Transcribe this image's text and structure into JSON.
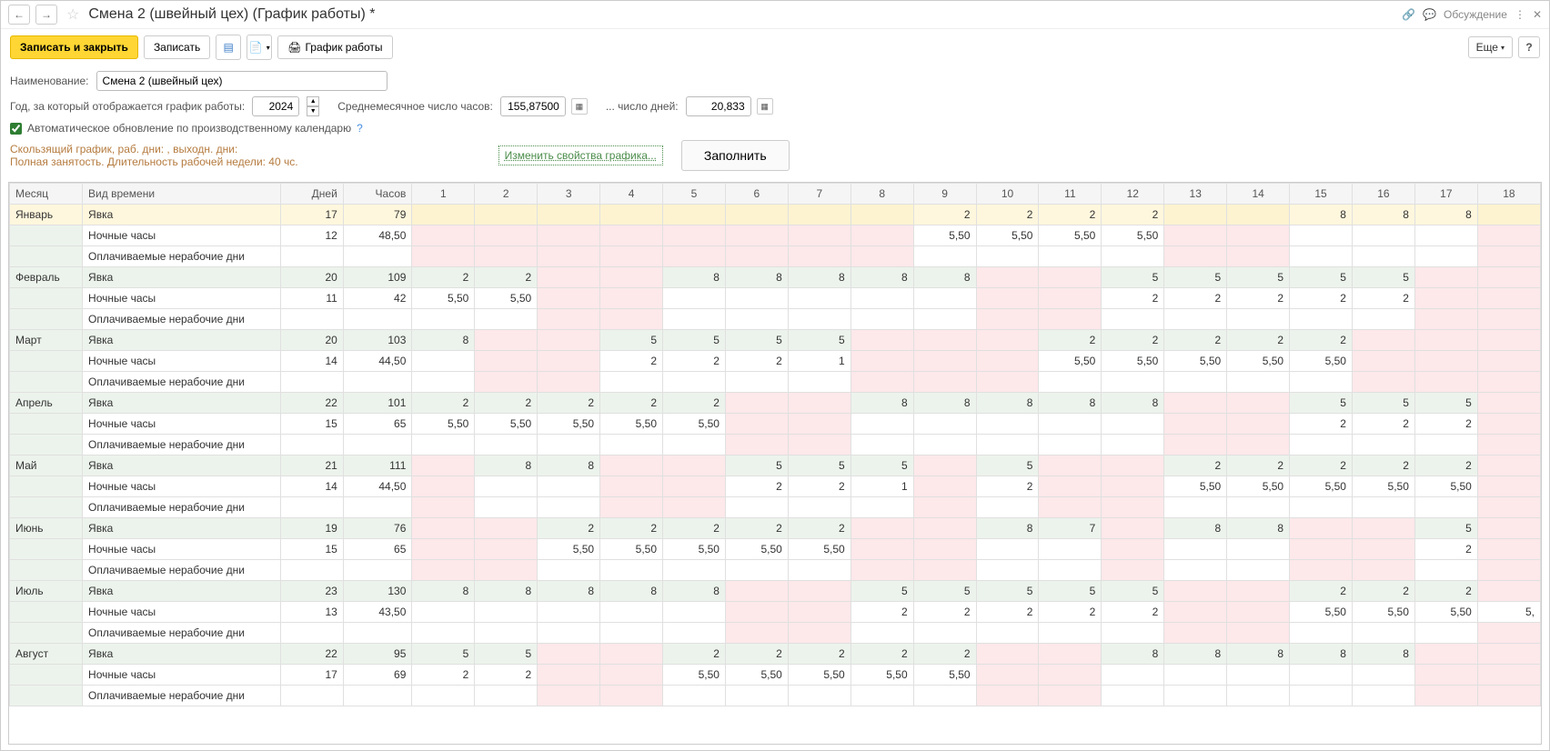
{
  "titlebar": {
    "title": "Смена 2 (швейный цех) (График работы) *",
    "discuss": "Обсуждение"
  },
  "toolbar": {
    "save_close": "Записать и закрыть",
    "save": "Записать",
    "schedule_btn": "График работы",
    "more": "Еще"
  },
  "form": {
    "name_label": "Наименование:",
    "name_value": "Смена 2 (швейный цех)",
    "year_label": "Год, за который отображается график работы:",
    "year_value": "2024",
    "avg_hours_label": "Среднемесячное число часов:",
    "avg_hours_value": "155,87500",
    "avg_days_label": "... число дней:",
    "avg_days_value": "20,833",
    "cb_label": "Автоматическое обновление по производственному календарю",
    "info1": "Скользящий график, раб. дни: , выходн. дни:",
    "info2": "Полная занятость. Длительность рабочей недели: 40 чс.",
    "change_link": "Изменить свойства графика...",
    "fill_btn": "Заполнить"
  },
  "grid": {
    "headers": {
      "month": "Месяц",
      "type": "Вид времени",
      "days": "Дней",
      "hours": "Часов"
    },
    "day_cols": [
      "1",
      "2",
      "3",
      "4",
      "5",
      "6",
      "7",
      "8",
      "9",
      "10",
      "11",
      "12",
      "13",
      "14",
      "15",
      "16",
      "17",
      "18"
    ],
    "type_labels": [
      "Явка",
      "Ночные часы",
      "Оплачиваемые нерабочие дни"
    ],
    "months": [
      {
        "name": "Январь",
        "days": "17",
        "hours": "79",
        "r1": {
          "cells": [
            "",
            "",
            "",
            "",
            "",
            "",
            "",
            "",
            "2",
            "2",
            "2",
            "2",
            "",
            "",
            "8",
            "8",
            "8",
            ""
          ],
          "pink": [
            0,
            1,
            2,
            3,
            4,
            5,
            6,
            7,
            12,
            13,
            17
          ]
        },
        "r2": {
          "cells": [
            "",
            "",
            "",
            "",
            "",
            "",
            "",
            "",
            "5,50",
            "5,50",
            "5,50",
            "5,50",
            "",
            "",
            "",
            "",
            "",
            ""
          ],
          "pink": [
            0,
            1,
            2,
            3,
            4,
            5,
            6,
            7,
            12,
            13,
            17
          ]
        },
        "r3": {
          "cells": [
            "",
            "",
            "",
            "",
            "",
            "",
            "",
            "",
            "",
            "",
            "",
            "",
            "",
            "",
            "",
            "",
            "",
            ""
          ],
          "pink": [
            0,
            1,
            2,
            3,
            4,
            5,
            6,
            7,
            12,
            13,
            17
          ]
        }
      },
      {
        "name": "Февраль",
        "days": "20",
        "hours": "109",
        "r1": {
          "cells": [
            "2",
            "2",
            "",
            "",
            "8",
            "8",
            "8",
            "8",
            "8",
            "",
            "",
            "5",
            "5",
            "5",
            "5",
            "5",
            "",
            ""
          ],
          "pink": [
            2,
            3,
            9,
            10,
            16,
            17
          ]
        },
        "r2": {
          "cells": [
            "5,50",
            "5,50",
            "",
            "",
            "",
            "",
            "",
            "",
            "",
            "",
            "",
            "2",
            "2",
            "2",
            "2",
            "2",
            "",
            ""
          ],
          "pink": [
            2,
            3,
            9,
            10,
            16,
            17
          ]
        },
        "r3": {
          "cells": [
            "",
            "",
            "",
            "",
            "",
            "",
            "",
            "",
            "",
            "",
            "",
            "",
            "",
            "",
            "",
            "",
            "",
            ""
          ],
          "pink": [
            2,
            3,
            9,
            10,
            16,
            17
          ]
        },
        "days2": "11",
        "hours2": "42"
      },
      {
        "name": "Март",
        "days": "20",
        "hours": "103",
        "r1": {
          "cells": [
            "8",
            "",
            "",
            "5",
            "5",
            "5",
            "5",
            "",
            "",
            "",
            "2",
            "2",
            "2",
            "2",
            "2",
            "",
            "",
            ""
          ],
          "pink": [
            1,
            2,
            7,
            8,
            9,
            15,
            16,
            17
          ]
        },
        "r2": {
          "cells": [
            "",
            "",
            "",
            "2",
            "2",
            "2",
            "1",
            "",
            "",
            "",
            "5,50",
            "5,50",
            "5,50",
            "5,50",
            "5,50",
            "",
            "",
            ""
          ],
          "pink": [
            1,
            2,
            7,
            8,
            9,
            15,
            16,
            17
          ]
        },
        "r3": {
          "cells": [
            "",
            "",
            "",
            "",
            "",
            "",
            "",
            "",
            "",
            "",
            "",
            "",
            "",
            "",
            "",
            "",
            "",
            ""
          ],
          "pink": [
            1,
            2,
            7,
            8,
            9,
            15,
            16,
            17
          ]
        },
        "days2": "14",
        "hours2": "44,50"
      },
      {
        "name": "Апрель",
        "days": "22",
        "hours": "101",
        "r1": {
          "cells": [
            "2",
            "2",
            "2",
            "2",
            "2",
            "",
            "",
            "8",
            "8",
            "8",
            "8",
            "8",
            "",
            "",
            "5",
            "5",
            "5",
            ""
          ],
          "pink": [
            5,
            6,
            12,
            13,
            17
          ]
        },
        "r2": {
          "cells": [
            "5,50",
            "5,50",
            "5,50",
            "5,50",
            "5,50",
            "",
            "",
            "",
            "",
            "",
            "",
            "",
            "",
            "",
            "2",
            "2",
            "2",
            ""
          ],
          "pink": [
            5,
            6,
            12,
            13,
            17
          ]
        },
        "r3": {
          "cells": [
            "",
            "",
            "",
            "",
            "",
            "",
            "",
            "",
            "",
            "",
            "",
            "",
            "",
            "",
            "",
            "",
            "",
            ""
          ],
          "pink": [
            5,
            6,
            12,
            13,
            17
          ]
        },
        "days2": "15",
        "hours2": "65"
      },
      {
        "name": "Май",
        "days": "21",
        "hours": "111",
        "r1": {
          "cells": [
            "",
            "8",
            "8",
            "",
            "",
            "5",
            "5",
            "5",
            "",
            "5",
            "",
            "",
            "2",
            "2",
            "2",
            "2",
            "2",
            ""
          ],
          "pink": [
            0,
            3,
            4,
            8,
            10,
            11,
            17
          ]
        },
        "r2": {
          "cells": [
            "",
            "",
            "",
            "",
            "",
            "2",
            "2",
            "1",
            "",
            "2",
            "",
            "",
            "5,50",
            "5,50",
            "5,50",
            "5,50",
            "5,50",
            ""
          ],
          "pink": [
            0,
            3,
            4,
            8,
            10,
            11,
            17
          ]
        },
        "r3": {
          "cells": [
            "",
            "",
            "",
            "",
            "",
            "",
            "",
            "",
            "",
            "",
            "",
            "",
            "",
            "",
            "",
            "",
            "",
            ""
          ],
          "pink": [
            0,
            3,
            4,
            8,
            10,
            11,
            17
          ]
        },
        "days2": "14",
        "hours2": "44,50"
      },
      {
        "name": "Июнь",
        "days": "19",
        "hours": "76",
        "r1": {
          "cells": [
            "",
            "",
            "2",
            "2",
            "2",
            "2",
            "2",
            "",
            "",
            "8",
            "7",
            "",
            "8",
            "8",
            "",
            "",
            "5",
            ""
          ],
          "pink": [
            0,
            1,
            7,
            8,
            11,
            14,
            15,
            17
          ]
        },
        "r2": {
          "cells": [
            "",
            "",
            "5,50",
            "5,50",
            "5,50",
            "5,50",
            "5,50",
            "",
            "",
            "",
            "",
            "",
            "",
            "",
            "",
            "",
            "2",
            ""
          ],
          "pink": [
            0,
            1,
            7,
            8,
            11,
            14,
            15,
            17
          ]
        },
        "r3": {
          "cells": [
            "",
            "",
            "",
            "",
            "",
            "",
            "",
            "",
            "",
            "",
            "",
            "",
            "",
            "",
            "",
            "",
            "",
            ""
          ],
          "pink": [
            0,
            1,
            7,
            8,
            11,
            14,
            15,
            17
          ]
        },
        "days2": "15",
        "hours2": "65"
      },
      {
        "name": "Июль",
        "days": "23",
        "hours": "130",
        "r1": {
          "cells": [
            "8",
            "8",
            "8",
            "8",
            "8",
            "",
            "",
            "5",
            "5",
            "5",
            "5",
            "5",
            "",
            "",
            "2",
            "2",
            "2",
            ""
          ],
          "pink": [
            5,
            6,
            12,
            13,
            17
          ]
        },
        "r2": {
          "cells": [
            "",
            "",
            "",
            "",
            "",
            "",
            "",
            "2",
            "2",
            "2",
            "2",
            "2",
            "",
            "",
            "5,50",
            "5,50",
            "5,50",
            "5,"
          ],
          "pink": [
            5,
            6,
            12,
            13
          ]
        },
        "r3": {
          "cells": [
            "",
            "",
            "",
            "",
            "",
            "",
            "",
            "",
            "",
            "",
            "",
            "",
            "",
            "",
            "",
            "",
            "",
            ""
          ],
          "pink": [
            5,
            6,
            12,
            13,
            17
          ]
        },
        "days2": "13",
        "hours2": "43,50"
      },
      {
        "name": "Август",
        "days": "22",
        "hours": "95",
        "r1": {
          "cells": [
            "5",
            "5",
            "",
            "",
            "2",
            "2",
            "2",
            "2",
            "2",
            "",
            "",
            "8",
            "8",
            "8",
            "8",
            "8",
            "",
            ""
          ],
          "pink": [
            2,
            3,
            9,
            10,
            16,
            17
          ]
        },
        "r2": {
          "cells": [
            "2",
            "2",
            "",
            "",
            "5,50",
            "5,50",
            "5,50",
            "5,50",
            "5,50",
            "",
            "",
            "",
            "",
            "",
            "",
            "",
            "",
            ""
          ],
          "pink": [
            2,
            3,
            9,
            10,
            16,
            17
          ]
        },
        "r3": {
          "cells": [
            "",
            "",
            "",
            "",
            "",
            "",
            "",
            "",
            "",
            "",
            "",
            "",
            "",
            "",
            "",
            "",
            "",
            ""
          ],
          "pink": [
            2,
            3,
            9,
            10,
            16,
            17
          ]
        },
        "days2": "17",
        "hours2": "69"
      }
    ]
  }
}
